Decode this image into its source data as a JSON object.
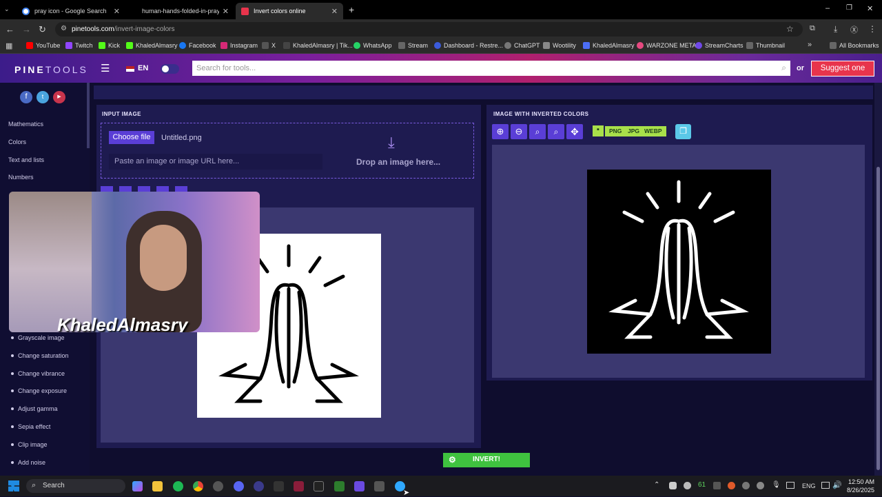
{
  "browser": {
    "tabs": [
      {
        "title": "pray icon - Google Search",
        "active": false
      },
      {
        "title": "human-hands-folded-in-prayer",
        "active": false
      },
      {
        "title": "Invert colors online",
        "active": true
      }
    ],
    "url_host": "pinetools.com",
    "url_path": "/invert-image-colors",
    "bookmarks": [
      "YouTube",
      "Twitch",
      "Kick",
      "KhaledAlmasry",
      "Facebook",
      "Instagram",
      "X",
      "KhaledAlmasry | Tik...",
      "WhatsApp",
      "Stream",
      "Dashboard - Restre...",
      "ChatGPT",
      "Wootility",
      "KhaledAlmasry",
      "WARZONE META",
      "StreamCharts",
      "Thumbnail"
    ],
    "all_bookmarks": "All Bookmarks"
  },
  "site": {
    "logo_a": "PINE",
    "logo_b": "TOOLS",
    "lang": "EN",
    "search_placeholder": "Search for tools...",
    "or_label": "or",
    "suggest_label": "Suggest one"
  },
  "sidebar": {
    "categories": [
      "Mathematics",
      "Colors",
      "Text and lists",
      "Numbers"
    ],
    "tools": [
      "Grayscale image",
      "Change saturation",
      "Change vibrance",
      "Change exposure",
      "Adjust gamma",
      "Sepia effect",
      "Clip image",
      "Add noise"
    ]
  },
  "input_panel": {
    "title": "INPUT IMAGE",
    "choose_label": "Choose file",
    "file_name": "Untitled.png",
    "paste_placeholder": "Paste an image or image URL here...",
    "drop_label": "Drop an image here..."
  },
  "output_panel": {
    "title": "IMAGE WITH INVERTED COLORS",
    "formats": [
      "PNG",
      "JPG",
      "WEBP"
    ]
  },
  "invert_label": "INVERT!",
  "webcam_overlay": {
    "name": "KhaledAlmasry"
  },
  "taskbar": {
    "search_label": "Search",
    "tray_number": "61",
    "lang": "ENG",
    "time": "12:50 AM",
    "date": "8/26/2025"
  },
  "colors": {
    "accent": "#5a3ed6",
    "format_buttons": "#a8e04a",
    "invert_button": "#3fc23f",
    "suggest_button": "#e8344c"
  }
}
